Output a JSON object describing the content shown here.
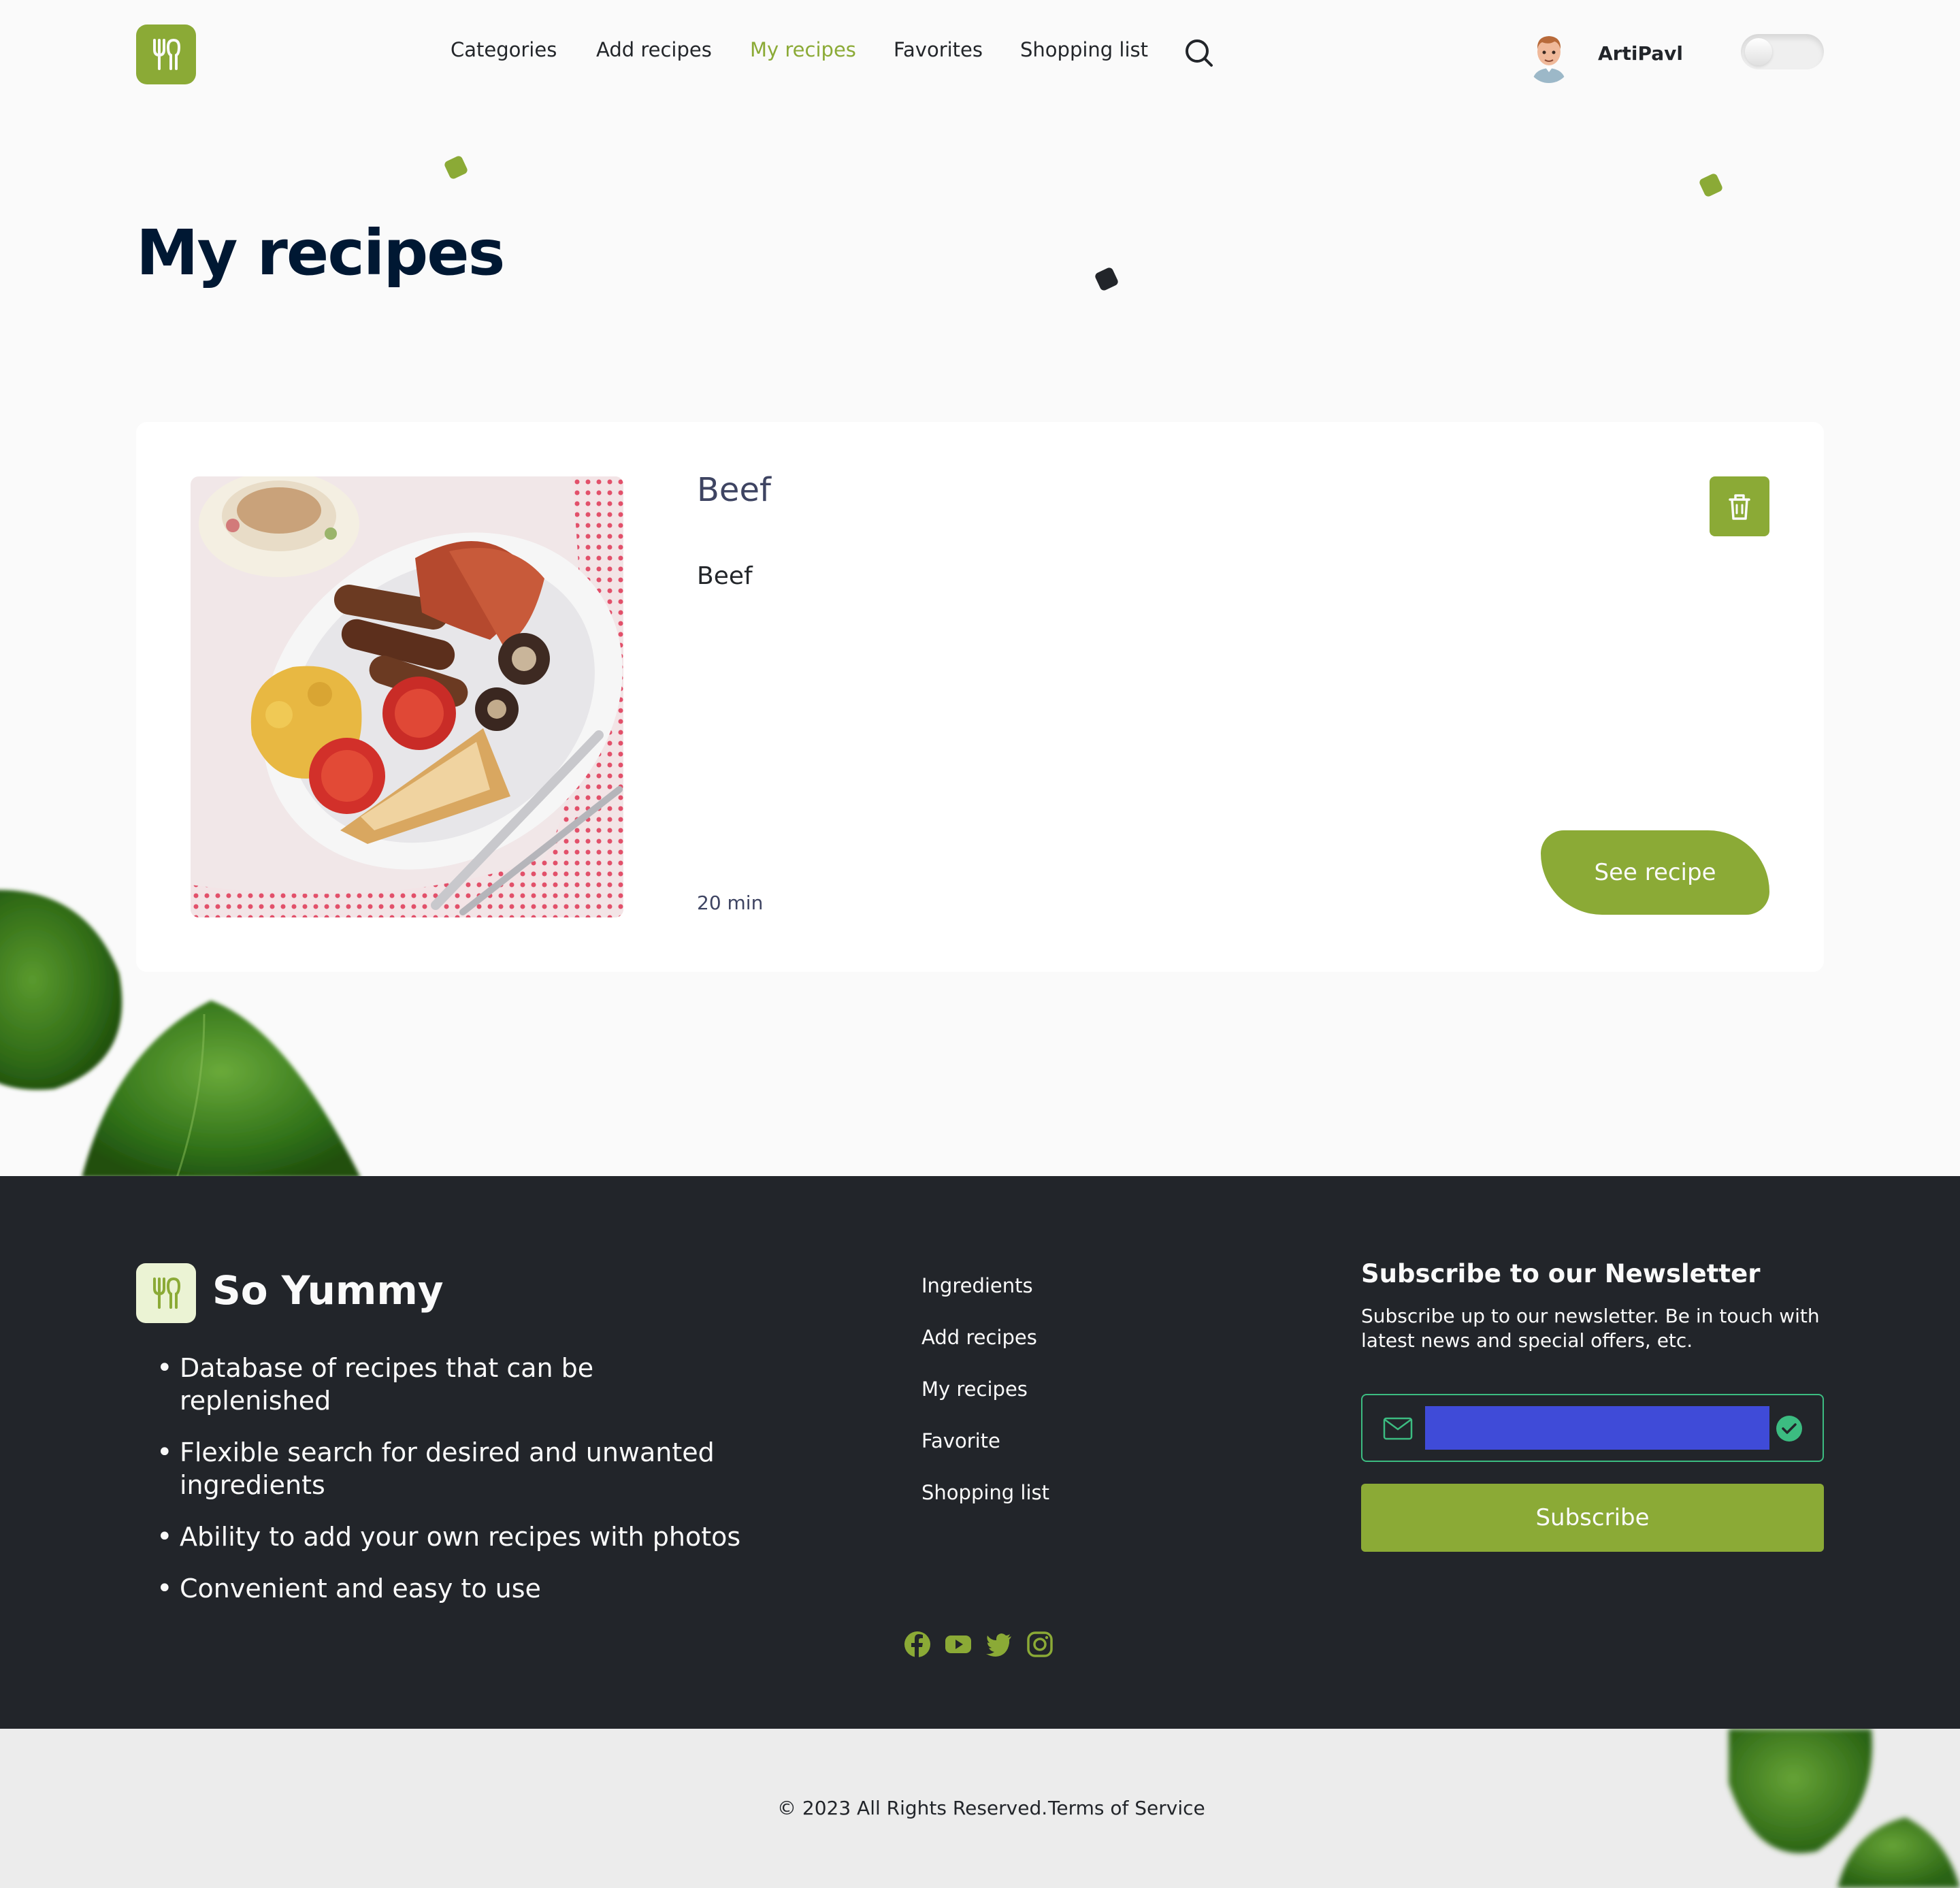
{
  "header": {
    "nav": [
      {
        "label": "Categories",
        "active": false
      },
      {
        "label": "Add recipes",
        "active": false
      },
      {
        "label": "My recipes",
        "active": true
      },
      {
        "label": "Favorites",
        "active": false
      },
      {
        "label": "Shopping list",
        "active": false
      }
    ],
    "user_name": "ArtiPavl",
    "search_icon": "search-icon",
    "theme_toggle_on": false
  },
  "page": {
    "title": "My recipes"
  },
  "recipes": [
    {
      "title": "Beef",
      "description": "Beef",
      "time": "20 min",
      "see_label": "See recipe",
      "delete_icon": "trash-icon"
    }
  ],
  "footer": {
    "brand": "So Yummy",
    "features": [
      "Database of recipes that can be replenished",
      "Flexible search for desired and unwanted ingredients",
      "Ability to add your own recipes with photos",
      "Convenient and easy to use"
    ],
    "nav": [
      "Ingredients",
      "Add recipes",
      "My recipes",
      "Favorite",
      "Shopping list"
    ],
    "newsletter": {
      "title": "Subscribe to our Newsletter",
      "text": "Subscribe up to our newsletter. Be in touch with latest news and special offers, etc.",
      "email_value": "",
      "button": "Subscribe"
    },
    "socials": [
      "facebook-icon",
      "youtube-icon",
      "twitter-icon",
      "instagram-icon"
    ],
    "copyright": "© 2023 All Rights Reserved.",
    "terms": "Terms of Service"
  },
  "colors": {
    "accent": "#8baa36",
    "dark": "#22252a",
    "title": "#001833",
    "input_fill": "#3f4bd8",
    "valid": "#3cbc81"
  }
}
